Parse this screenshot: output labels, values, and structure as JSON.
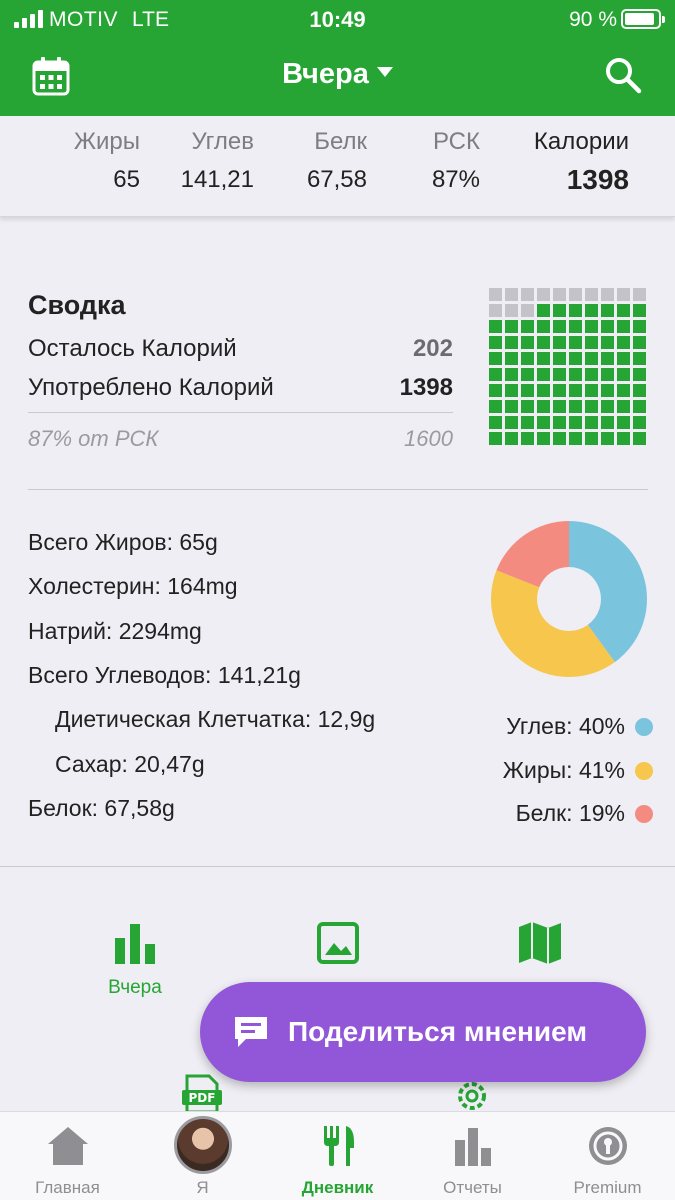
{
  "status_bar": {
    "carrier": "MOTIV",
    "network": "LTE",
    "time": "10:49",
    "battery": "90 %"
  },
  "header": {
    "date_title": "Вчера",
    "calendar_icon": "calendar-icon",
    "search_icon": "search-icon",
    "brand_color": "#27a534"
  },
  "macros": [
    {
      "label": "Жиры",
      "value": "65"
    },
    {
      "label": "Углев",
      "value": "141,21"
    },
    {
      "label": "Белк",
      "value": "67,58"
    },
    {
      "label": "РСК",
      "value": "87%"
    },
    {
      "label": "Калории",
      "value": "1398"
    }
  ],
  "summary": {
    "title": "Сводка",
    "remaining_label": "Осталось Калорий",
    "remaining_value": "202",
    "consumed_label": "Употреблено Калорий",
    "consumed_value": "1398",
    "rdi_label": "87% от РСК",
    "rdi_value": "1600",
    "grid_filled_fraction": 0.87
  },
  "nutrients": {
    "fat": "Всего Жиров: 65g",
    "cholesterol": "Холестерин: 164mg",
    "sodium": "Натрий: 2294mg",
    "carbs": "Всего Углеводов: 141,21g",
    "fiber": "Диетическая Клетчатка: 12,9g",
    "sugar": "Сахар: 20,47g",
    "protein": "Белок: 67,58g"
  },
  "chart_data": {
    "type": "pie",
    "categories": [
      "Углев",
      "Жиры",
      "Белк"
    ],
    "values": [
      40,
      41,
      19
    ],
    "labels": [
      "Углев: 40%",
      "Жиры: 41%",
      "Белк: 19%"
    ],
    "colors": [
      "#7bc4de",
      "#f7c64d",
      "#f38b80"
    ]
  },
  "shortcuts": {
    "yesterday_label": "Вчера",
    "icons": [
      "bar-chart-icon",
      "image-icon",
      "map-icon",
      "pdf-icon",
      "settings-icon"
    ]
  },
  "feedback": {
    "label": "Поделиться мнением",
    "color": "#9256d8"
  },
  "tabs": [
    {
      "label": "Главная",
      "icon": "home-icon"
    },
    {
      "label": "Я",
      "icon": "avatar"
    },
    {
      "label": "Дневник",
      "icon": "utensils-icon"
    },
    {
      "label": "Отчеты",
      "icon": "reports-icon"
    },
    {
      "label": "Premium",
      "icon": "premium-icon"
    }
  ]
}
